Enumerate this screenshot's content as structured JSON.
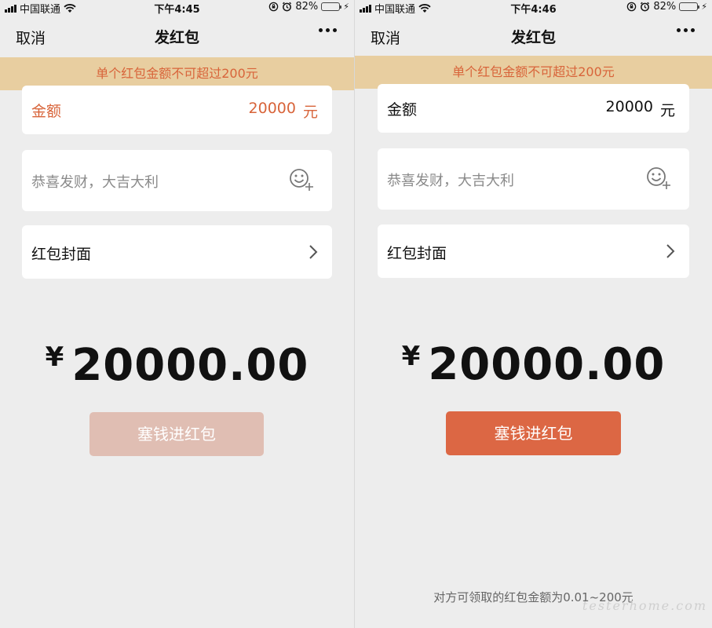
{
  "screens": [
    {
      "status": {
        "carrier": "中国联通",
        "time": "下午4:45",
        "battery_pct": "82%",
        "battery_level": 0.82,
        "battery_color": "#4cd964"
      },
      "nav": {
        "cancel": "取消",
        "title": "发红包",
        "more_icon": "more-dots-icon"
      },
      "banner": "单个红包金额不可超过200元",
      "amount": {
        "label": "金额",
        "value": "20000",
        "unit": "元",
        "state": "error",
        "text_color": "#d8643a"
      },
      "greeting": {
        "placeholder": "恭喜发财，大吉大利",
        "icon": "emoji-add-icon"
      },
      "cover": {
        "label": "红包封面",
        "icon": "chevron-right-icon"
      },
      "total": {
        "currency": "¥",
        "amount": "20000.00"
      },
      "submit": {
        "label": "塞钱进红包",
        "enabled": false,
        "color": "#e0beb3"
      },
      "footer_note": ""
    },
    {
      "status": {
        "carrier": "中国联通",
        "time": "下午4:46",
        "battery_pct": "82%",
        "battery_level": 0.82,
        "battery_color": "#4cd964"
      },
      "nav": {
        "cancel": "取消",
        "title": "发红包",
        "more_icon": "more-dots-icon"
      },
      "banner": "单个红包金额不可超过200元",
      "amount": {
        "label": "金额",
        "value": "20000",
        "unit": "元",
        "state": "normal",
        "text_color": "#111111"
      },
      "greeting": {
        "placeholder": "恭喜发财，大吉大利",
        "icon": "emoji-add-icon"
      },
      "cover": {
        "label": "红包封面",
        "icon": "chevron-right-icon"
      },
      "total": {
        "currency": "¥",
        "amount": "20000.00"
      },
      "submit": {
        "label": "塞钱进红包",
        "enabled": true,
        "color": "#dc6744"
      },
      "footer_note": "对方可领取的红包金额为0.01~200元"
    }
  ],
  "watermark": "testerhome.com",
  "colors": {
    "background": "#ededed",
    "banner_bg": "#e8cea0",
    "banner_text": "#d8643a"
  }
}
